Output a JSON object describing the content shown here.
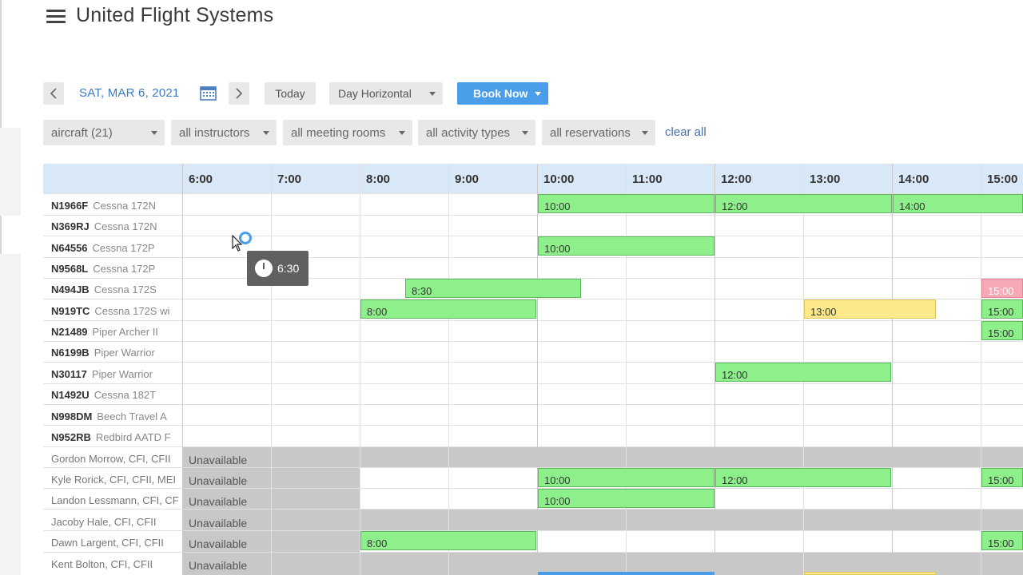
{
  "app": {
    "title": "United Flight Systems"
  },
  "toolbar": {
    "date_label": "SAT, MAR 6, 2021",
    "today_label": "Today",
    "view_label": "Day Horizontal",
    "book_label": "Book Now"
  },
  "filters": {
    "aircraft": "aircraft (21)",
    "instructors": "all instructors",
    "meeting_rooms": "all meeting rooms",
    "activity_types": "all activity types",
    "reservations": "all reservations",
    "clear_all": "clear all"
  },
  "times": [
    "6:00",
    "7:00",
    "8:00",
    "9:00",
    "10:00",
    "11:00",
    "12:00",
    "13:00",
    "14:00",
    "15:00"
  ],
  "aircraft": [
    {
      "tail": "N1966F",
      "model": "Cessna 172N"
    },
    {
      "tail": "N369RJ",
      "model": "Cessna 172N"
    },
    {
      "tail": "N64556",
      "model": "Cessna 172P"
    },
    {
      "tail": "N9568L",
      "model": "Cessna 172P"
    },
    {
      "tail": "N494JB",
      "model": "Cessna 172S"
    },
    {
      "tail": "N919TC",
      "model": "Cessna 172S wi"
    },
    {
      "tail": "N21489",
      "model": "Piper Archer II"
    },
    {
      "tail": "N6199B",
      "model": "Piper Warrior"
    },
    {
      "tail": "N30117",
      "model": "Piper Warrior"
    },
    {
      "tail": "N1492U",
      "model": "Cessna 182T"
    },
    {
      "tail": "N998DM",
      "model": "Beech Travel A"
    },
    {
      "tail": "N952RB",
      "model": "Redbird AATD F"
    }
  ],
  "instructors": [
    {
      "name": "Gordon Morrow, CFI, CFII",
      "status": "Unavailable"
    },
    {
      "name": "Kyle Rorick, CFI, CFII, MEI",
      "status": "Unavailable"
    },
    {
      "name": "Landon Lessmann, CFI, CF",
      "status": "Unavailable"
    },
    {
      "name": "Jacoby Hale, CFI, CFII",
      "status": "Unavailable"
    },
    {
      "name": "Dawn Largent, CFI, CFII",
      "status": "Unavailable"
    },
    {
      "name": "Kent Bolton, CFI, CFII",
      "status": "Unavailable"
    }
  ],
  "bookings": {
    "b1": "10:00",
    "b2": "12:00",
    "b3": "14:00",
    "b4": "10:00",
    "b5": "8:30",
    "b6": "15:00",
    "b7": "8:00",
    "b8": "13:00",
    "b9": "15:00",
    "b10": "15:00",
    "b11": "12:00",
    "b12": "10:00",
    "b13": "12:00",
    "b14": "15:00",
    "b15": "10:00",
    "b16": "8:00",
    "b17": "15:00"
  },
  "tooltip": {
    "time": "6:30"
  },
  "colors": {
    "accent": "#4a9de8",
    "booking_green": "#8ef08a",
    "booking_yellow": "#fde98a",
    "booking_pink": "#f7a8b5",
    "header_blue": "#d9e8f6"
  }
}
